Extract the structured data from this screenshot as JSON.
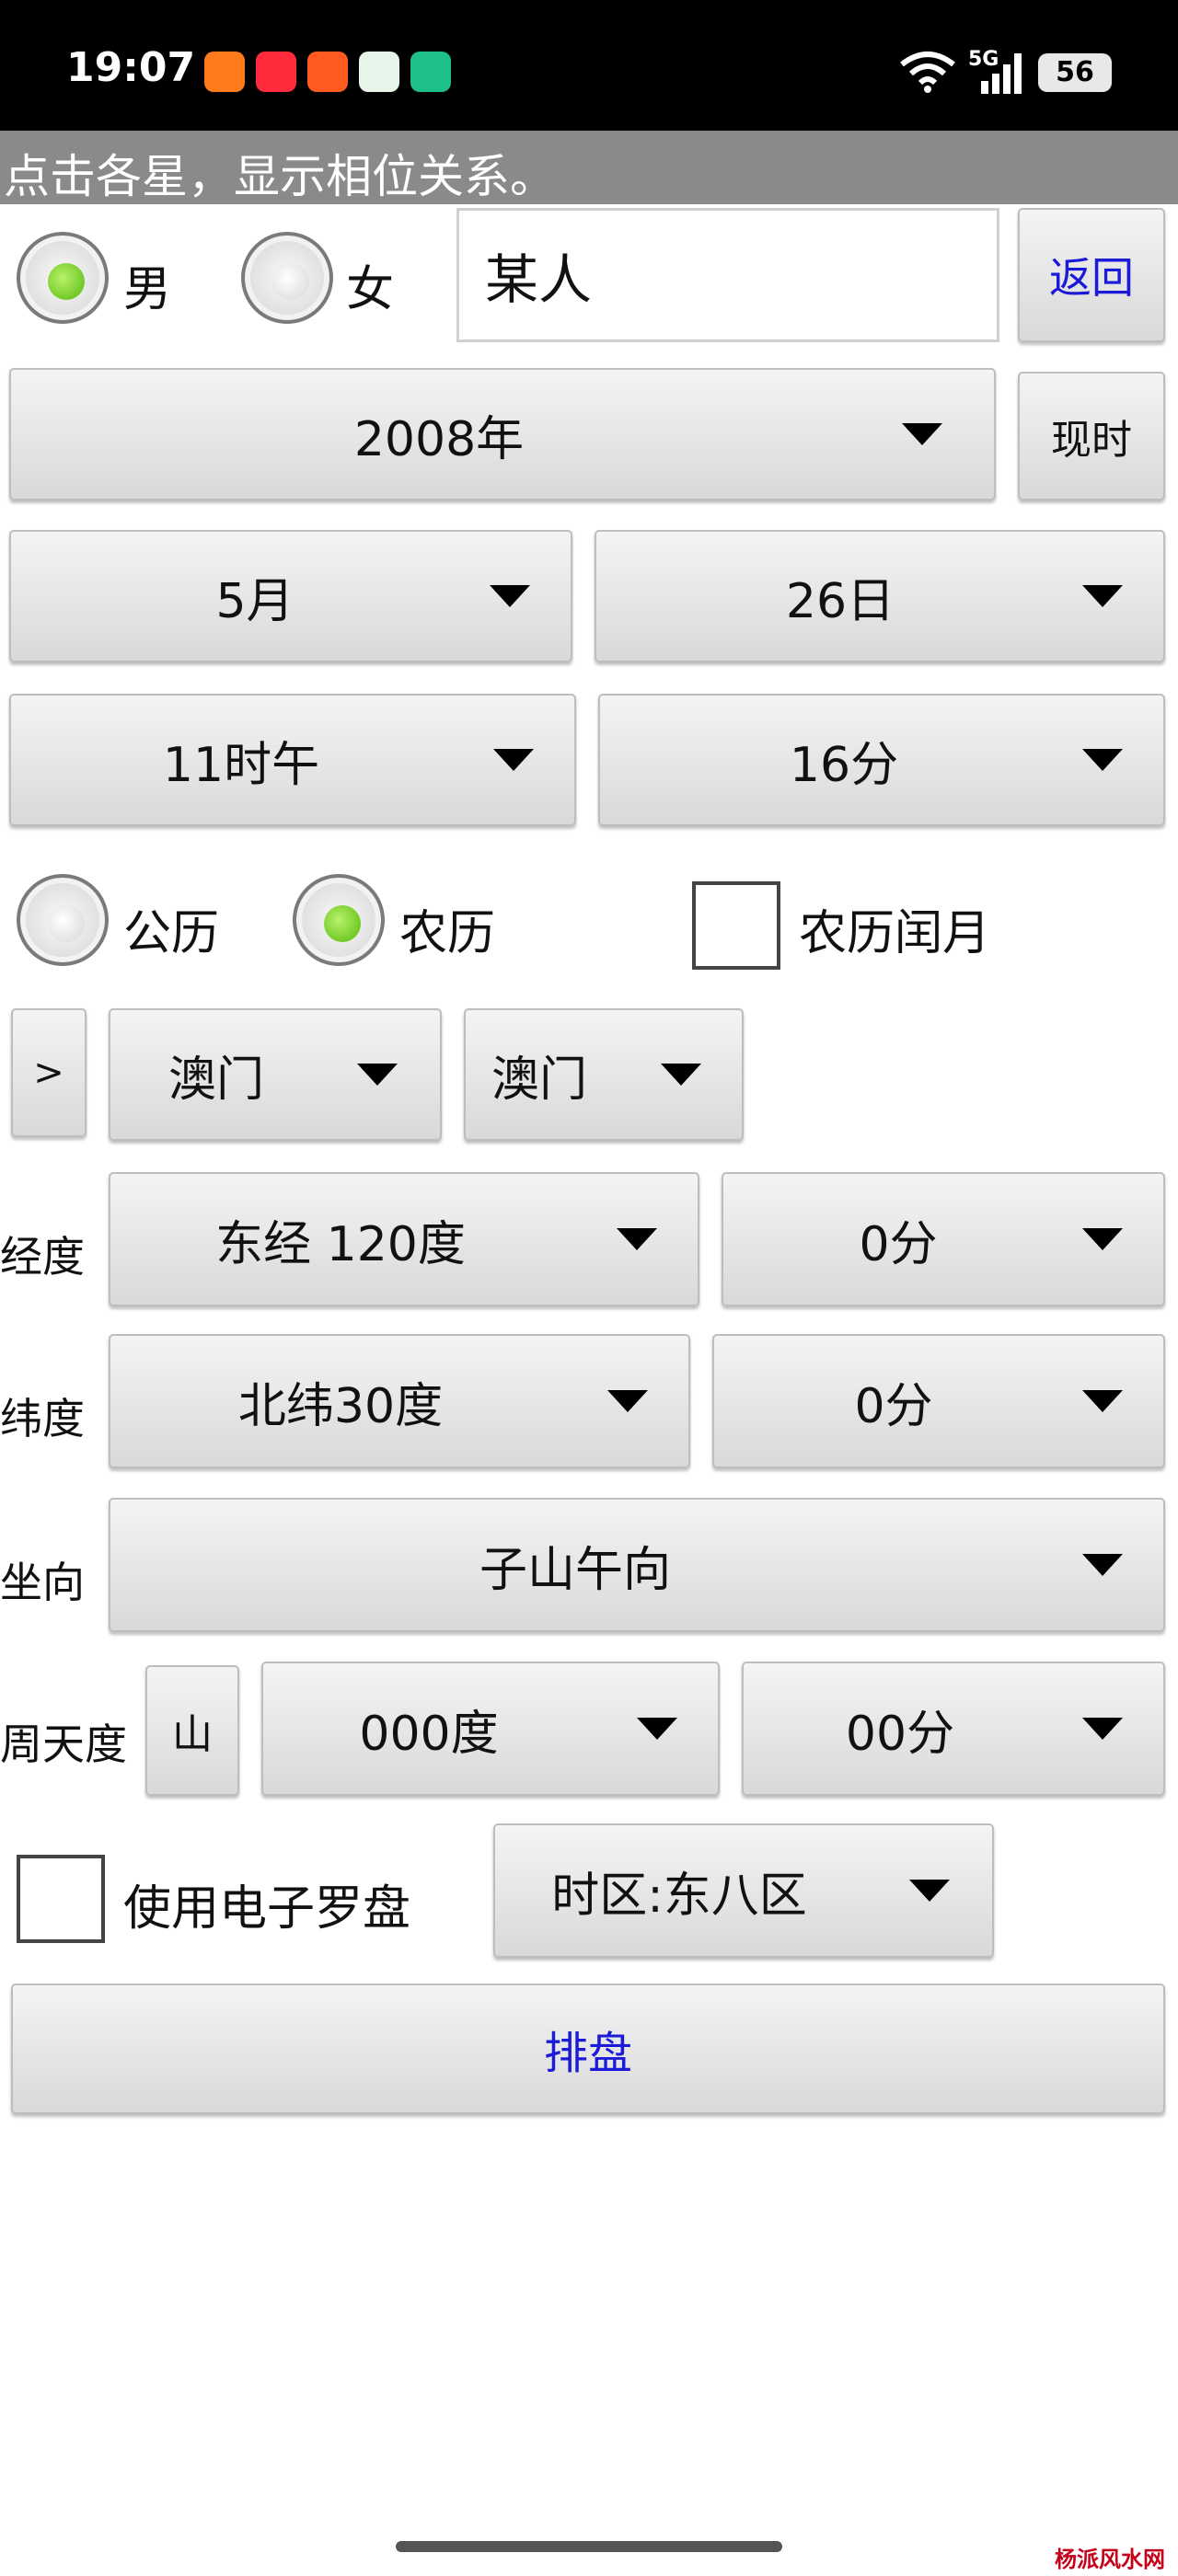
{
  "status": {
    "time": "19:07",
    "network": "5G",
    "battery": "56"
  },
  "hint": "点击各星，显示相位关系。",
  "gender": {
    "male_label": "男",
    "female_label": "女",
    "selected": "男"
  },
  "name_input": {
    "value": "某人"
  },
  "buttons": {
    "back": "返回",
    "now": "现时",
    "expand": ">",
    "mountain": "山",
    "chart": "排盘"
  },
  "date": {
    "year": "2008年",
    "month": "5月",
    "day": "26日",
    "hour": "11时午",
    "minute": "16分"
  },
  "calendar": {
    "solar_label": "公历",
    "lunar_label": "农历",
    "selected": "农历",
    "leap_month_label": "农历闰月",
    "leap_month_checked": false
  },
  "location": {
    "region": "澳门",
    "city": "澳门"
  },
  "longitude": {
    "label": "经度",
    "degrees": "东经 120度",
    "minutes": "0分"
  },
  "latitude": {
    "label": "纬度",
    "degrees": "北纬30度",
    "minutes": "0分"
  },
  "orientation": {
    "label": "坐向",
    "value": "子山午向"
  },
  "zhoutian": {
    "label": "周天度",
    "degrees": "000度",
    "minutes": "00分"
  },
  "compass": {
    "label": "使用电子罗盘",
    "checked": false
  },
  "timezone": {
    "value": "时区:东八区"
  },
  "watermark": "杨派风水网",
  "colors": {
    "radio_on": "#55b80c",
    "link_blue": "#1a1ad8",
    "hint_bar": "#8a8a8a"
  }
}
